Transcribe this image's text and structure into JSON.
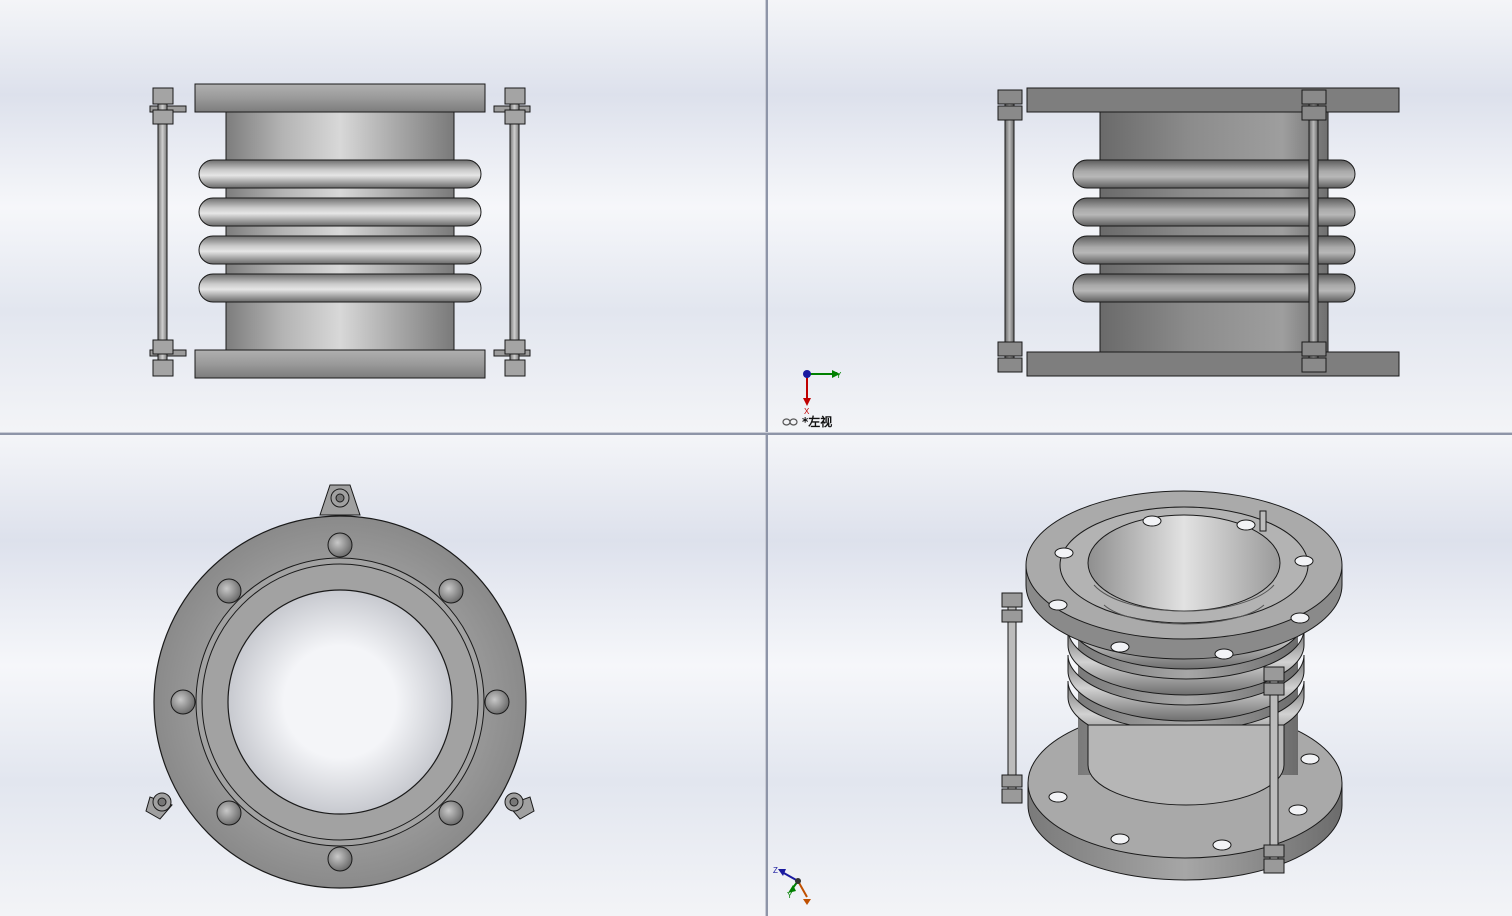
{
  "viewports": {
    "top_left": {
      "name": "front-view"
    },
    "top_right": {
      "name": "left-view",
      "label": "*左视"
    },
    "bottom_left": {
      "name": "top-view"
    },
    "bottom_right": {
      "name": "isometric-view"
    }
  },
  "triad_left_view": {
    "axis_1": "Y",
    "axis_2": "X"
  },
  "triad_iso_view": {
    "axis_1": "Z",
    "axis_2": "Y"
  },
  "colors": {
    "metal": "#9a9a9a",
    "outline": "#1a1a1a",
    "x_axis": "#c00000",
    "y_axis": "#008000",
    "z_axis": "#1a1aa0"
  },
  "icons": [
    "view-orientation-glasses-icon",
    "coordinate-triad-icon"
  ]
}
